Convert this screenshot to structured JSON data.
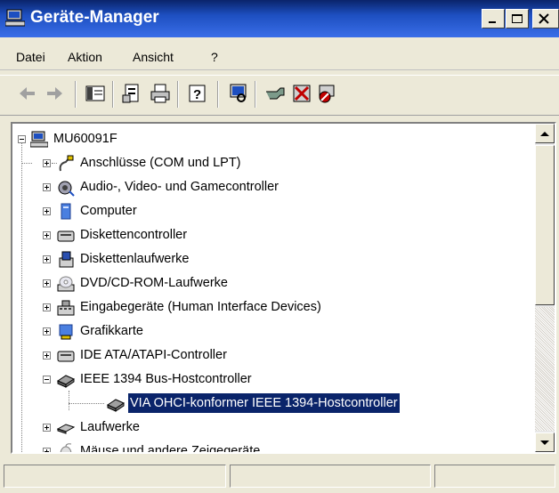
{
  "window": {
    "title": "Geräte-Manager",
    "title_color": "#ffffff",
    "titlebar_color": "#0a246a",
    "controls": [
      "minimize",
      "maximize",
      "close"
    ]
  },
  "menu": {
    "items": [
      {
        "label": "Datei"
      },
      {
        "label": "Aktion"
      },
      {
        "label": "Ansicht"
      },
      {
        "label": "?"
      }
    ]
  },
  "toolbar": {
    "icons": [
      "back-icon",
      "forward-icon",
      "show-hide-tree-icon",
      "properties-icon",
      "print-icon",
      "help-icon",
      "scan-hardware-icon",
      "update-driver-icon",
      "uninstall-icon",
      "disable-icon"
    ]
  },
  "tree": {
    "root": "MU60091F",
    "items": [
      {
        "label": "Anschlüsse (COM und LPT)",
        "icon": "port-icon"
      },
      {
        "label": "Audio-, Video- und Gamecontroller",
        "icon": "audio-icon"
      },
      {
        "label": "Computer",
        "icon": "computer-icon"
      },
      {
        "label": "Diskettencontroller",
        "icon": "floppy-controller-icon"
      },
      {
        "label": "Diskettenlaufwerke",
        "icon": "floppy-drive-icon"
      },
      {
        "label": "DVD/CD-ROM-Laufwerke",
        "icon": "cdrom-icon"
      },
      {
        "label": "Eingabegeräte (Human Interface Devices)",
        "icon": "hid-icon"
      },
      {
        "label": "Grafikkarte",
        "icon": "display-adapter-icon"
      },
      {
        "label": "IDE ATA/ATAPI-Controller",
        "icon": "ide-controller-icon"
      },
      {
        "label": "IEEE 1394 Bus-Hostcontroller",
        "icon": "ieee1394-icon",
        "expanded": true
      },
      {
        "label": "VIA OHCI-konformer IEEE 1394-Hostcontroller",
        "icon": "ieee1394-device-icon",
        "child": true,
        "selected": true
      },
      {
        "label": "Laufwerke",
        "icon": "disk-drive-icon"
      },
      {
        "label": "Mäuse und andere Zeigegeräte",
        "icon": "mouse-icon"
      }
    ],
    "selection_color": "#0a246a"
  },
  "statusbar": {
    "panes": [
      "",
      "",
      ""
    ]
  }
}
